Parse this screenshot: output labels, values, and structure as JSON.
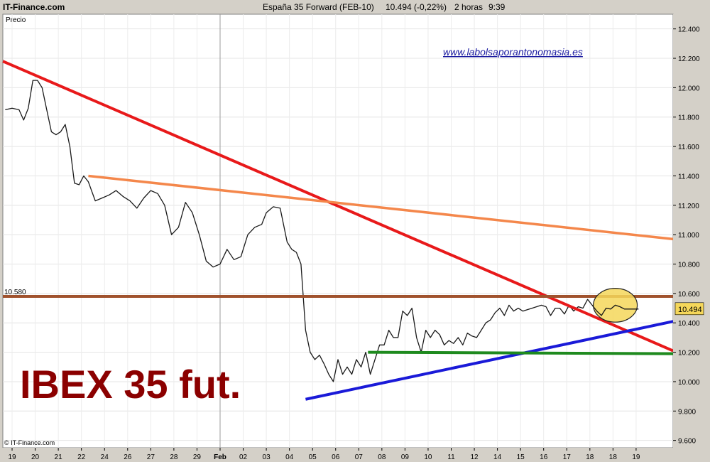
{
  "header": {
    "site": "IT-Finance.com",
    "instrument": "España 35 Forward (FEB-10)",
    "quote": "10.494 (-0,22%)",
    "timeframe": "2 horas",
    "time": "9:39"
  },
  "panel_label": "Precio",
  "watermark_url": "www.labolsaporantonomasia.es",
  "copyright": "© IT-Finance.com",
  "colors": {
    "downtrend": "#e8191a",
    "resistance": "#f4874b",
    "level": "#a0522d",
    "uptrend": "#1a1ad8",
    "support": "#1e8a1e",
    "highlight": "#f5d75a",
    "title": "#8b0000",
    "price_tag": "#f5d75a"
  },
  "chart_data": {
    "type": "line",
    "title": "IBEX 35 fut.",
    "ylim": [
      9550,
      12500
    ],
    "y_ticks": [
      "12.400",
      "12.200",
      "12.000",
      "11.800",
      "11.600",
      "11.400",
      "11.200",
      "11.000",
      "10.800",
      "10.600",
      "10.400",
      "10.200",
      "10.000",
      "9.800",
      "9.600"
    ],
    "y_tick_values": [
      12400,
      12200,
      12000,
      11800,
      11600,
      11400,
      11200,
      11000,
      10800,
      10600,
      10400,
      10200,
      10000,
      9800,
      9600
    ],
    "x_ticks": [
      "19",
      "20",
      "21",
      "22",
      "24",
      "26",
      "27",
      "28",
      "29",
      "Feb",
      "02",
      "03",
      "04",
      "05",
      "06",
      "07",
      "08",
      "09",
      "10",
      "11",
      "12",
      "14",
      "15",
      "16",
      "17",
      "18",
      "18",
      "19"
    ],
    "x_tick_positions": [
      0,
      1,
      2,
      3,
      4,
      5,
      6,
      7,
      8,
      9,
      10,
      11,
      12,
      13,
      14,
      15,
      16,
      17,
      18,
      19,
      20,
      21,
      22,
      23,
      24,
      25,
      26,
      27
    ],
    "xlim": [
      -0.4,
      28.6
    ],
    "last_price_label": "10.494",
    "level_label": "10.580",
    "price_series": {
      "x": [
        -0.3,
        0,
        0.3,
        0.5,
        0.7,
        0.9,
        1.1,
        1.3,
        1.5,
        1.7,
        1.9,
        2.1,
        2.3,
        2.5,
        2.7,
        2.9,
        3.1,
        3.3,
        3.6,
        3.9,
        4.2,
        4.5,
        4.8,
        5.1,
        5.4,
        5.7,
        6.0,
        6.3,
        6.6,
        6.9,
        7.2,
        7.5,
        7.8,
        8.1,
        8.4,
        8.7,
        9.0,
        9.3,
        9.6,
        9.9,
        10.2,
        10.5,
        10.8,
        11.0,
        11.3,
        11.6,
        11.9,
        12.1,
        12.3,
        12.5,
        12.7,
        12.9,
        13.1,
        13.3,
        13.5,
        13.7,
        13.9,
        14.1,
        14.3,
        14.5,
        14.7,
        14.9,
        15.1,
        15.3,
        15.5,
        15.7,
        15.9,
        16.1,
        16.3,
        16.5,
        16.7,
        16.9,
        17.1,
        17.3,
        17.5,
        17.7,
        17.9,
        18.1,
        18.3,
        18.5,
        18.7,
        18.9,
        19.1,
        19.3,
        19.5,
        19.7,
        19.9,
        20.1,
        20.3,
        20.5,
        20.7,
        20.9,
        21.1,
        21.3,
        21.5,
        21.7,
        21.9,
        22.1,
        22.3,
        22.5,
        22.7,
        22.9,
        23.1,
        23.3,
        23.5,
        23.7,
        23.9,
        24.1,
        24.3,
        24.5,
        24.7,
        24.9,
        25.1,
        25.3,
        25.5,
        25.7,
        25.9,
        26.1,
        26.3,
        26.5,
        26.7,
        26.9,
        27.1
      ],
      "y": [
        11850,
        11860,
        11850,
        11780,
        11860,
        12050,
        12050,
        12000,
        11850,
        11700,
        11680,
        11700,
        11750,
        11600,
        11350,
        11340,
        11400,
        11360,
        11230,
        11250,
        11270,
        11300,
        11260,
        11230,
        11180,
        11250,
        11300,
        11280,
        11200,
        11000,
        11050,
        11220,
        11150,
        11000,
        10820,
        10780,
        10800,
        10900,
        10830,
        10850,
        11000,
        11050,
        11070,
        11150,
        11190,
        11180,
        10950,
        10900,
        10880,
        10800,
        10350,
        10200,
        10150,
        10180,
        10120,
        10050,
        10000,
        10150,
        10050,
        10100,
        10050,
        10150,
        10100,
        10200,
        10050,
        10150,
        10250,
        10250,
        10350,
        10300,
        10300,
        10480,
        10450,
        10500,
        10300,
        10200,
        10350,
        10300,
        10350,
        10320,
        10250,
        10280,
        10260,
        10300,
        10250,
        10330,
        10310,
        10300,
        10350,
        10400,
        10420,
        10470,
        10500,
        10450,
        10520,
        10480,
        10500,
        10480,
        10490,
        10500,
        10510,
        10520,
        10510,
        10450,
        10500,
        10500,
        10460,
        10520,
        10480,
        10510,
        10500,
        10560,
        10520,
        10480,
        10450,
        10500,
        10494,
        10520,
        10510,
        10494,
        10494,
        10494,
        10494
      ]
    },
    "trendlines": [
      {
        "color_key": "downtrend",
        "x": [
          -0.4,
          28.6
        ],
        "y": [
          12180,
          10210
        ]
      },
      {
        "color_key": "resistance",
        "x": [
          3.3,
          28.6
        ],
        "y": [
          11400,
          10970
        ]
      },
      {
        "color_key": "level",
        "x": [
          -0.4,
          28.6
        ],
        "y": [
          10580,
          10580
        ]
      },
      {
        "color_key": "uptrend",
        "x": [
          12.7,
          28.6
        ],
        "y": [
          9880,
          10410
        ]
      },
      {
        "color_key": "support",
        "x": [
          15.4,
          28.6
        ],
        "y": [
          10200,
          10190
        ]
      }
    ],
    "highlight": {
      "x": 26.1,
      "y": 10520,
      "rx": 0.95,
      "ry": 115
    },
    "vertical_marker_x": 9
  }
}
